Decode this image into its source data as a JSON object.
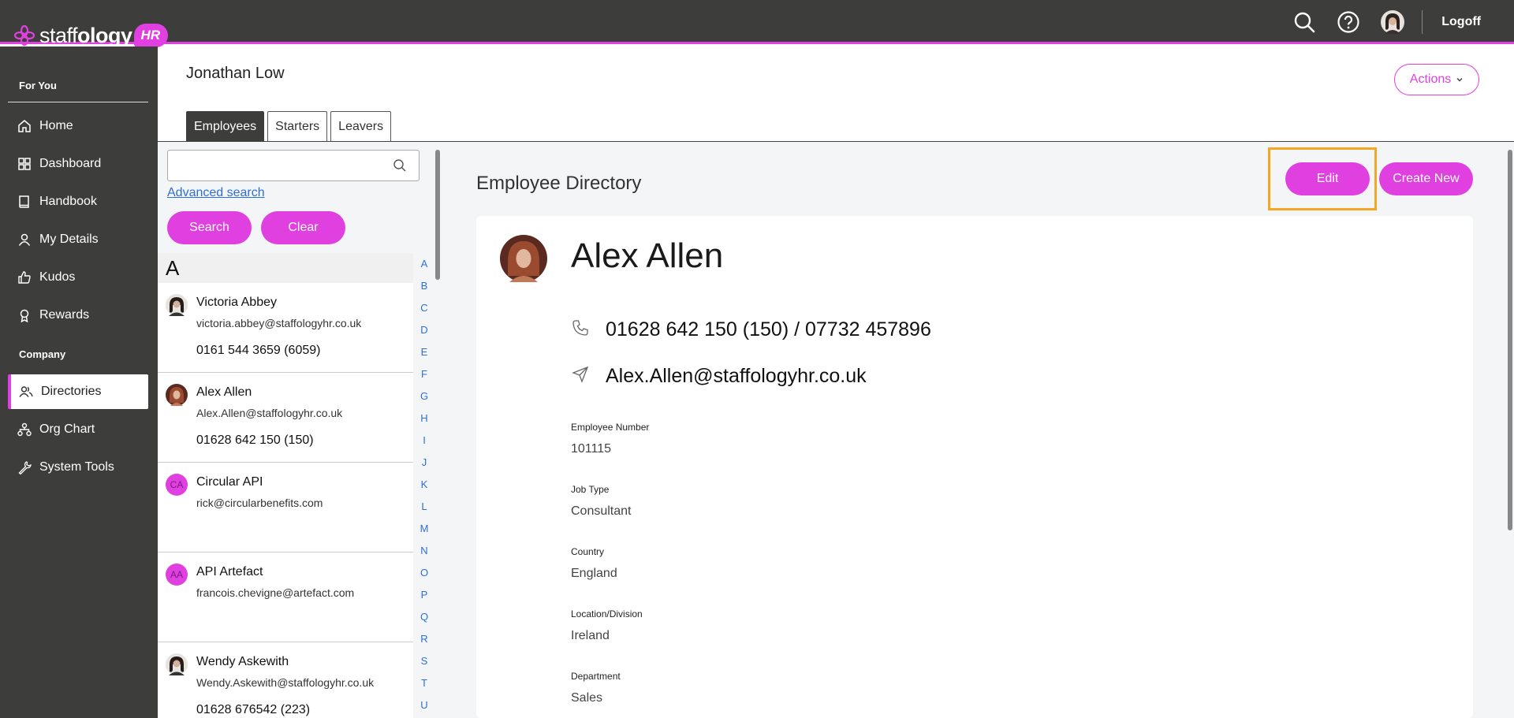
{
  "brand": {
    "name_light": "staff",
    "name_bold": "ology",
    "badge": "HR"
  },
  "topbar": {
    "logoff_label": "Logoff"
  },
  "sidebar": {
    "section_for_you": "For You",
    "section_company": "Company",
    "items": [
      {
        "label": "Home",
        "icon": "home-icon"
      },
      {
        "label": "Dashboard",
        "icon": "dashboard-icon"
      },
      {
        "label": "Handbook",
        "icon": "book-icon"
      },
      {
        "label": "My Details",
        "icon": "user-icon"
      },
      {
        "label": "Kudos",
        "icon": "thumbs-up-icon"
      },
      {
        "label": "Rewards",
        "icon": "award-icon"
      },
      {
        "label": "Directories",
        "icon": "users-icon",
        "active": true
      },
      {
        "label": "Org Chart",
        "icon": "org-chart-icon"
      },
      {
        "label": "System Tools",
        "icon": "wrench-icon"
      }
    ]
  },
  "header": {
    "user_name": "Jonathan Low",
    "actions_label": "Actions"
  },
  "tabs": [
    {
      "label": "Employees",
      "active": true
    },
    {
      "label": "Starters"
    },
    {
      "label": "Leavers"
    }
  ],
  "directory": {
    "search_value": "",
    "advanced_search_label": "Advanced search",
    "search_button": "Search",
    "clear_button": "Clear",
    "current_letter": "A",
    "alphabet": [
      "A",
      "B",
      "C",
      "D",
      "E",
      "F",
      "G",
      "H",
      "I",
      "J",
      "K",
      "L",
      "M",
      "N",
      "O",
      "P",
      "Q",
      "R",
      "S",
      "T",
      "U"
    ],
    "entries": [
      {
        "name": "Victoria Abbey",
        "email": "victoria.abbey@staffologyhr.co.uk",
        "phone": "0161 544 3659 (6059)",
        "avatar": "photo"
      },
      {
        "name": "Alex Allen",
        "email": "Alex.Allen@staffologyhr.co.uk",
        "phone": "01628 642 150 (150)",
        "avatar": "photo"
      },
      {
        "name": "Circular API",
        "email": "rick@circularbenefits.com",
        "phone": "",
        "avatar": "initials",
        "initials": "CA"
      },
      {
        "name": "API Artefact",
        "email": "francois.chevigne@artefact.com",
        "phone": "",
        "avatar": "initials",
        "initials": "AA"
      },
      {
        "name": "Wendy Askewith",
        "email": "Wendy.Askewith@staffologyhr.co.uk",
        "phone": "01628 676542 (223)",
        "avatar": "photo"
      }
    ]
  },
  "detail": {
    "title": "Employee Directory",
    "edit_button": "Edit",
    "create_button": "Create New",
    "name": "Alex Allen",
    "phone_line": "01628 642 150 (150) / 07732 457896",
    "email_line": "Alex.Allen@staffologyhr.co.uk",
    "fields": [
      {
        "label": "Employee Number",
        "value": "101115"
      },
      {
        "label": "Job Type",
        "value": "Consultant"
      },
      {
        "label": "Country",
        "value": "England"
      },
      {
        "label": "Location/Division",
        "value": "Ireland"
      },
      {
        "label": "Department",
        "value": "Sales"
      }
    ]
  },
  "colors": {
    "accent": "#e040e0",
    "chrome": "#3d3d3b",
    "highlight": "#f5a623",
    "link": "#2e6fd6"
  }
}
